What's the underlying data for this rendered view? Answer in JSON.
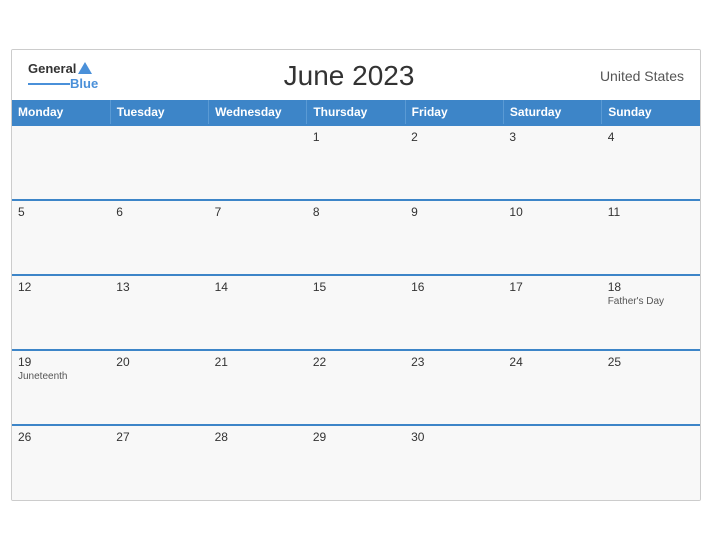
{
  "header": {
    "title": "June 2023",
    "region": "United States",
    "logo_general": "General",
    "logo_blue": "Blue"
  },
  "weekdays": [
    "Monday",
    "Tuesday",
    "Wednesday",
    "Thursday",
    "Friday",
    "Saturday",
    "Sunday"
  ],
  "weeks": [
    [
      {
        "day": "",
        "event": ""
      },
      {
        "day": "",
        "event": ""
      },
      {
        "day": "",
        "event": ""
      },
      {
        "day": "1",
        "event": ""
      },
      {
        "day": "2",
        "event": ""
      },
      {
        "day": "3",
        "event": ""
      },
      {
        "day": "4",
        "event": ""
      }
    ],
    [
      {
        "day": "5",
        "event": ""
      },
      {
        "day": "6",
        "event": ""
      },
      {
        "day": "7",
        "event": ""
      },
      {
        "day": "8",
        "event": ""
      },
      {
        "day": "9",
        "event": ""
      },
      {
        "day": "10",
        "event": ""
      },
      {
        "day": "11",
        "event": ""
      }
    ],
    [
      {
        "day": "12",
        "event": ""
      },
      {
        "day": "13",
        "event": ""
      },
      {
        "day": "14",
        "event": ""
      },
      {
        "day": "15",
        "event": ""
      },
      {
        "day": "16",
        "event": ""
      },
      {
        "day": "17",
        "event": ""
      },
      {
        "day": "18",
        "event": "Father's Day"
      }
    ],
    [
      {
        "day": "19",
        "event": "Juneteenth"
      },
      {
        "day": "20",
        "event": ""
      },
      {
        "day": "21",
        "event": ""
      },
      {
        "day": "22",
        "event": ""
      },
      {
        "day": "23",
        "event": ""
      },
      {
        "day": "24",
        "event": ""
      },
      {
        "day": "25",
        "event": ""
      }
    ],
    [
      {
        "day": "26",
        "event": ""
      },
      {
        "day": "27",
        "event": ""
      },
      {
        "day": "28",
        "event": ""
      },
      {
        "day": "29",
        "event": ""
      },
      {
        "day": "30",
        "event": ""
      },
      {
        "day": "",
        "event": ""
      },
      {
        "day": "",
        "event": ""
      }
    ]
  ]
}
